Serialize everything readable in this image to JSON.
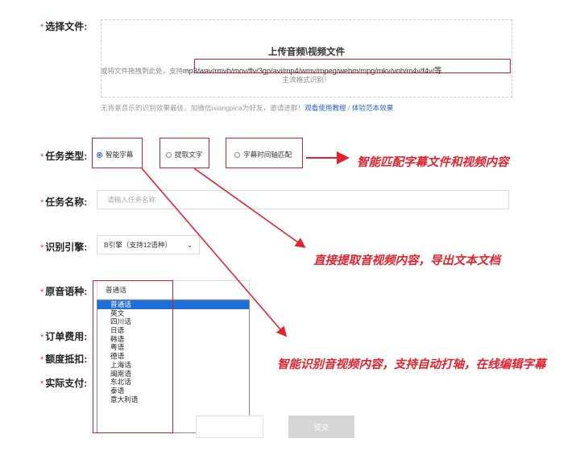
{
  "form": {
    "required_mark": "*",
    "file_label": "选择文件:",
    "task_type_label": "任务类型:",
    "task_name_label": "任务名称:",
    "engine_label": "识别引擎:",
    "language_label": "原音语种:",
    "fee_label": "订单费用:",
    "quota_label": "额度抵扣:",
    "pay_label": "实际支付:"
  },
  "upload": {
    "title": "上传音频\\视频文件",
    "desc_prefix": "或将文件拖拽到此处，支持",
    "formats": "mp3/wav/rmvb/mov/flv/3gp/avi/mp4/wmv/mpeg/webm/mpg/mkv/vob/m4v/f4v/等",
    "desc_line2": "主流格式识别！"
  },
  "tip": {
    "text": "无背景音乐的识别效果最佳，加微信ixiangpica为好友，邀请进群！",
    "link1": "观看使用教程",
    "sep": " / ",
    "link2": "体验范本效果"
  },
  "task_types": [
    {
      "label": "智能字幕",
      "selected": true
    },
    {
      "label": "提取文字",
      "selected": false
    },
    {
      "label": "字幕时间轴匹配",
      "selected": false
    }
  ],
  "task_name": {
    "placeholder": "请输入任务名称"
  },
  "engine": {
    "value": "B引擎（支持12语种）"
  },
  "language": {
    "value": "普通话",
    "options": [
      "普通话",
      "英文",
      "四川话",
      "日语",
      "韩语",
      "粤语",
      "德语",
      "上海话",
      "闽南语",
      "东北话",
      "泰语",
      "意大利语"
    ],
    "selected_index": 0
  },
  "submit": {
    "label": "提交"
  },
  "annotations": {
    "a1": "智能匹配字幕文件和视频内容",
    "a2": "直接提取音视频内容，导出文本文档",
    "a3": "智能识别音视频内容，支持自动打轴，在线编辑字幕"
  },
  "colors": {
    "annotation_red": "#e0232e",
    "link_blue": "#2a62c9",
    "select_blue": "#1e6fd9"
  }
}
